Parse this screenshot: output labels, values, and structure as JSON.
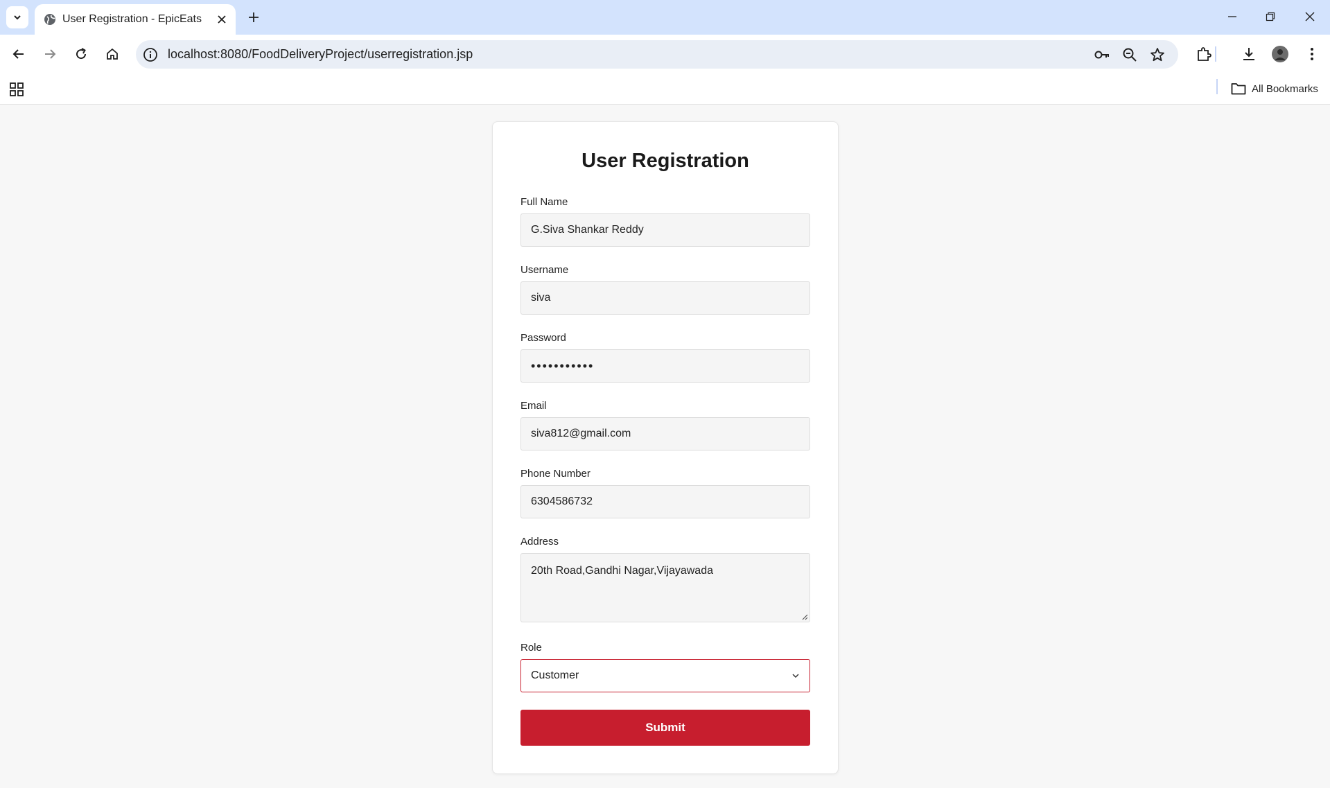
{
  "browser": {
    "tab_title": "User Registration - EpicEats",
    "url": "localhost:8080/FoodDeliveryProject/userregistration.jsp",
    "bookmarks_label": "All Bookmarks"
  },
  "form": {
    "title": "User Registration",
    "fields": {
      "full_name": {
        "label": "Full Name",
        "value": "G.Siva Shankar Reddy"
      },
      "username": {
        "label": "Username",
        "value": "siva"
      },
      "password": {
        "label": "Password",
        "value": "•••••••••••"
      },
      "email": {
        "label": "Email",
        "value": "siva812@gmail.com"
      },
      "phone": {
        "label": "Phone Number",
        "value": "6304586732"
      },
      "address": {
        "label": "Address",
        "value": "20th Road,Gandhi Nagar,Vijayawada"
      },
      "role": {
        "label": "Role",
        "value": "Customer"
      }
    },
    "submit_label": "Submit"
  },
  "colors": {
    "accent": "#c71e2e",
    "tabstrip": "#d3e3fd",
    "page_bg": "#f7f7f7"
  }
}
